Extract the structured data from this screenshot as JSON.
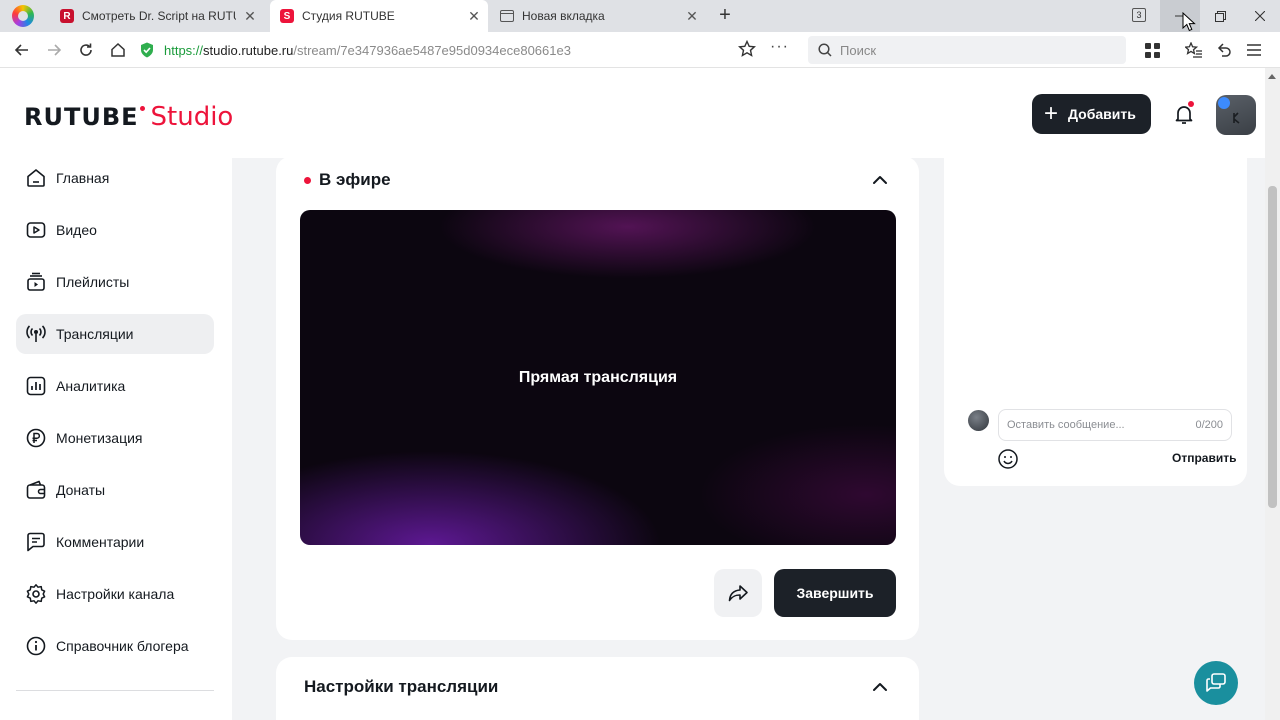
{
  "browser": {
    "tabs": [
      {
        "title": "Смотреть Dr. Script на RUTUBE",
        "favicon": "R",
        "favicon_color": "#c8102e",
        "active": false
      },
      {
        "title": "Студия RUTUBE",
        "favicon": "S",
        "favicon_color": "#ed143b",
        "active": true
      },
      {
        "title": "Новая вкладка",
        "favicon": "",
        "favicon_color": "#555555",
        "active": false
      }
    ],
    "tabs_count": "3",
    "url": {
      "scheme": "https://",
      "host": "studio.rutube.ru",
      "path": "/stream/7e347936ae5487e95d0934ece80661e3"
    },
    "search_placeholder": "Поиск"
  },
  "app": {
    "logo_main": "RUTUBE",
    "logo_sub": "Studio",
    "accent_color": "#ed143b",
    "add_button_label": "Добавить"
  },
  "sidebar": {
    "items": [
      {
        "label": "Главная",
        "icon": "home-icon",
        "active": false
      },
      {
        "label": "Видео",
        "icon": "video-icon",
        "active": false
      },
      {
        "label": "Плейлисты",
        "icon": "playlist-icon",
        "active": false
      },
      {
        "label": "Трансляции",
        "icon": "broadcast-icon",
        "active": true
      },
      {
        "label": "Аналитика",
        "icon": "analytics-icon",
        "active": false
      },
      {
        "label": "Монетизация",
        "icon": "ruble-icon",
        "active": false
      },
      {
        "label": "Донаты",
        "icon": "wallet-icon",
        "active": false
      },
      {
        "label": "Комментарии",
        "icon": "comment-icon",
        "active": false
      },
      {
        "label": "Настройки канала",
        "icon": "gear-icon",
        "active": false
      },
      {
        "label": "Справочник блогера",
        "icon": "info-icon",
        "active": false
      }
    ]
  },
  "live": {
    "title": "В эфире",
    "player_label": "Прямая трансляция",
    "finish_label": "Завершить"
  },
  "settings": {
    "title": "Настройки трансляции"
  },
  "chat": {
    "placeholder": "Оставить сообщение...",
    "counter": "0/200",
    "send_label": "Отправить"
  }
}
